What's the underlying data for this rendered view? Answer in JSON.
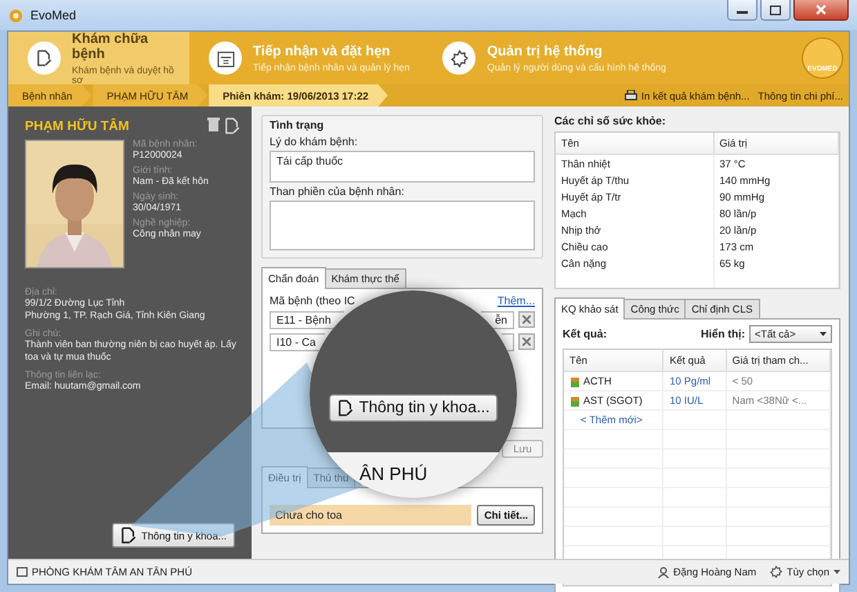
{
  "window": {
    "title": "EvoMed"
  },
  "nav_tabs": [
    {
      "kind": "note",
      "title": "Khám chữa bệnh",
      "subtitle": "Khám bệnh và duyệt hồ sơ",
      "selected": true
    },
    {
      "kind": "calendar",
      "title": "Tiếp nhận và đặt hẹn",
      "subtitle": "Tiếp nhận bệnh nhân và quản lý hẹn",
      "selected": false
    },
    {
      "kind": "gear",
      "title": "Quản trị hệ thống",
      "subtitle": "Quản lý người dùng và cấu hình hệ thống",
      "selected": false
    }
  ],
  "logo": {
    "text": "EVOMED"
  },
  "breadcrumb": [
    {
      "label": "Bệnh nhân",
      "selected": false
    },
    {
      "label": "PHẠM HỮU TÂM",
      "selected": false
    },
    {
      "label": "Phiên khám: 19/06/2013 17:22",
      "selected": true
    }
  ],
  "toolbar_links": [
    {
      "kind": "print",
      "label": "In kết quả khám bệnh..."
    },
    {
      "kind": "plain",
      "label": "Thông tin chi phí..."
    }
  ],
  "patient": {
    "name": "PHẠM HỮU TÂM",
    "fields": [
      {
        "label": "Mã bệnh nhân:",
        "value": "P12000024"
      },
      {
        "label": "Giới tính:",
        "value": "Nam - Đã kết hôn"
      },
      {
        "label": "Ngày sinh:",
        "value": "30/04/1971"
      },
      {
        "label": "Nghề nghiệp:",
        "value": "Công nhân may"
      }
    ],
    "details": [
      {
        "label": "Địa chỉ:",
        "lines": [
          "99/1/2 Đường Lục Tỉnh",
          "Phường 1, TP. Rạch Giá, Tỉnh Kiên Giang"
        ]
      },
      {
        "label": "Ghi chú:",
        "lines": [
          "Thành viên ban thường niên bị cao huyết áp. Lấy toa và tự mua thuốc"
        ]
      },
      {
        "label": "Thông tin liên lạc:",
        "lines": [
          "Email: huutam@gmail.com"
        ]
      }
    ],
    "button": "Thông tin y khoa..."
  },
  "condition": {
    "title": "Tình trạng",
    "reason_label": "Lý do khám bệnh:",
    "reason_value": "Tái cấp thuốc",
    "complaint_label": "Than phiền của bệnh nhân:"
  },
  "diagnosis": {
    "tabs": [
      {
        "label": "Chẩn đoán",
        "selected": true
      },
      {
        "label": "Khám thực thể",
        "selected": false
      }
    ],
    "code_label": "Mã bệnh (theo IC",
    "add_link": "Thêm...",
    "rows": [
      {
        "left": "E11 - Bệnh",
        "right": "ễn"
      },
      {
        "left": "I10 - Ca",
        "right": ""
      }
    ]
  },
  "save_button": "Lưu",
  "treatment": {
    "tabs": [
      {
        "label": "Điều trị",
        "selected": true
      },
      {
        "label": "Thủ thu",
        "selected": false
      }
    ],
    "prescription": "Chưa cho toa",
    "detail_button": "Chi tiết..."
  },
  "vitals": {
    "title": "Các chỉ số sức khỏe:",
    "columns": [
      "Tên",
      "Giá trị"
    ],
    "rows": [
      [
        "Thân nhiệt",
        "37 °C"
      ],
      [
        "Huyết áp T/thu",
        "140 mmHg"
      ],
      [
        "Huyết áp T/tr",
        "90 mmHg"
      ],
      [
        "Mạch",
        "80 lần/p"
      ],
      [
        "Nhịp thở",
        "20 lần/p"
      ],
      [
        "Chiều cao",
        "173 cm"
      ],
      [
        "Cân nặng",
        "65 kg"
      ]
    ]
  },
  "lab": {
    "tabs": [
      {
        "label": "KQ khảo sát",
        "selected": true
      },
      {
        "label": "Công thức",
        "selected": false
      },
      {
        "label": "Chỉ định CLS",
        "selected": false
      }
    ],
    "result_label": "Kết quả:",
    "filter_label": "Hiển thị:",
    "filter_value": "<Tất cả>",
    "columns": [
      "Tên",
      "Kết quả",
      "Giá trị tham ch..."
    ],
    "rows": [
      {
        "name": "ACTH",
        "result": "10 Pg/ml",
        "reference": "< 50"
      },
      {
        "name": "AST (SGOT)",
        "result": "10 IU/L",
        "reference": "Nam <38Nữ <..."
      }
    ],
    "add_new": "< Thêm mới>"
  },
  "status_bar": {
    "clinic": "PHÒNG KHÁM TÂM AN TÂN PHÚ",
    "user": "Đặng Hoàng Nam",
    "options": "Tùy chọn"
  },
  "magnifier": {
    "button": "Thông tin y khoa...",
    "caption": "ÂN PHÚ"
  }
}
